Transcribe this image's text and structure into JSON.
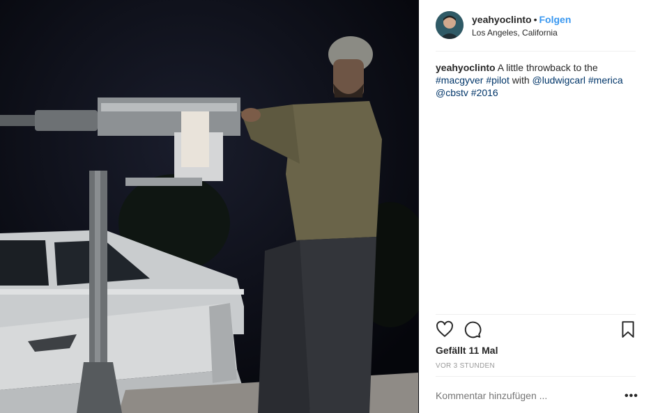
{
  "post": {
    "photo_label": "Photo",
    "username": "yeahyoclinto",
    "separator": "•",
    "follow_label": "Folgen",
    "location": "Los Angeles, California",
    "caption": {
      "username": "yeahyoclinto",
      "text_1": " A little throwback to the ",
      "tag_1": "#macgyver",
      "text_2": " ",
      "tag_2": "#pilot",
      "text_3": " with ",
      "mention_1": "@ludwigcarl",
      "text_4": " ",
      "tag_3": "#merica",
      "text_5": " ",
      "mention_2": "@cbstv",
      "text_6": " ",
      "tag_4": "#2016"
    },
    "likes": "Gefällt 11 Mal",
    "timestamp": "VOR 3 STUNDEN",
    "comment_placeholder": "Kommentar hinzufügen ...",
    "more_label": "•••"
  },
  "icons": {
    "like": "heart-icon",
    "comment": "comment-bubble-icon",
    "save": "bookmark-icon",
    "more": "more-options-icon"
  },
  "colors": {
    "link_blue": "#3897f0",
    "hashtag": "#003569",
    "muted": "#999999",
    "text": "#262626"
  }
}
